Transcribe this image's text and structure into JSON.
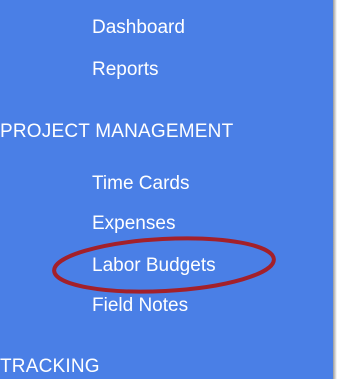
{
  "sidebar": {
    "top_items": [
      {
        "label": "Dashboard"
      },
      {
        "label": "Reports"
      }
    ],
    "sections": [
      {
        "heading": "PROJECT MANAGEMENT",
        "items": [
          {
            "label": "Time Cards"
          },
          {
            "label": "Expenses"
          },
          {
            "label": "Labor Budgets"
          },
          {
            "label": "Field Notes"
          }
        ]
      },
      {
        "heading": "TRACKING",
        "items": []
      }
    ]
  },
  "annotation": {
    "highlighted_item": "Labor Budgets",
    "color": "#a3202a"
  },
  "colors": {
    "sidebar_bg": "#4a7fe6",
    "text": "#ffffff"
  }
}
